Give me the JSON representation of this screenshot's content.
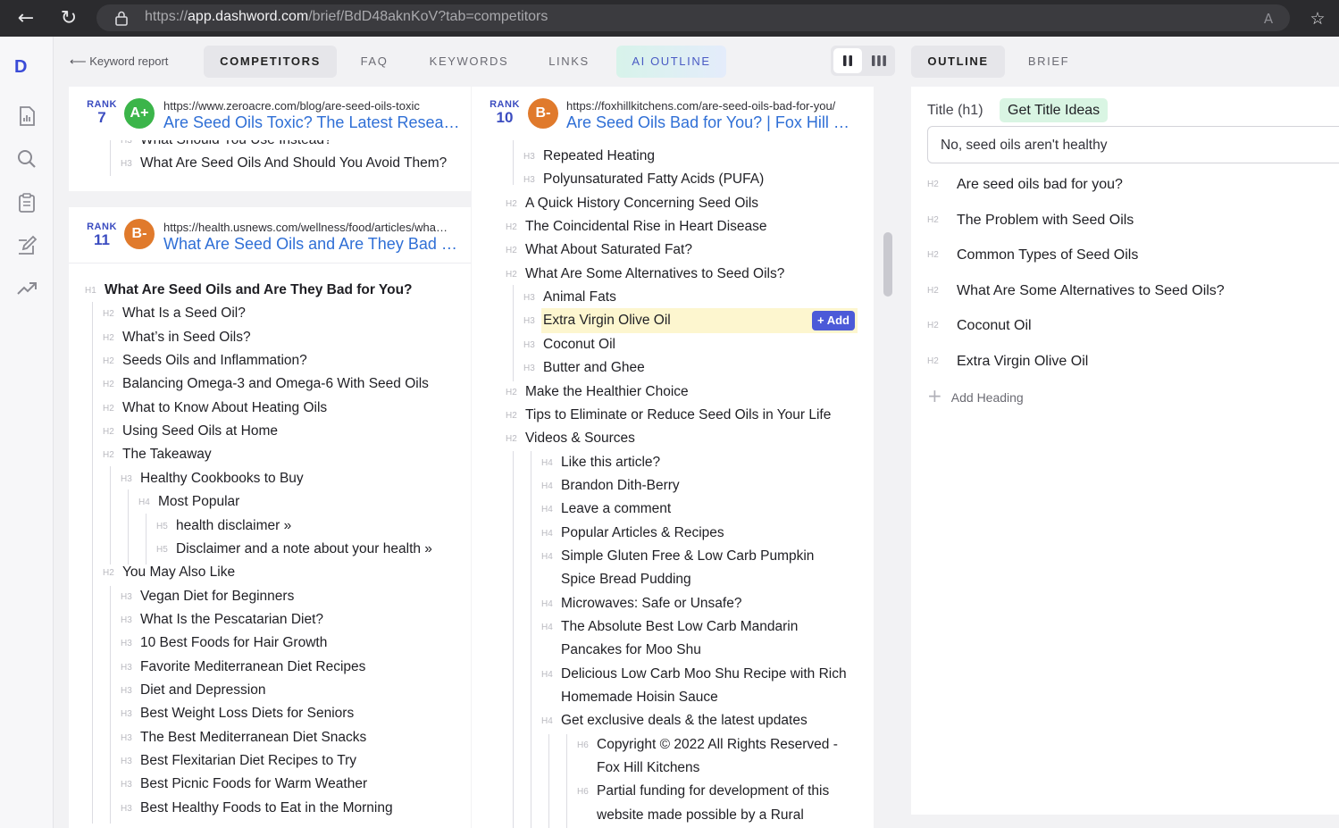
{
  "browser": {
    "url_prefix": "https://",
    "url_domain": "app.dashword.com",
    "url_path": "/brief/BdD48aknKoV?tab=competitors"
  },
  "app": {
    "logo": "D"
  },
  "nav": {
    "back_label": "Keyword report",
    "tabs": [
      "COMPETITORS",
      "FAQ",
      "KEYWORDS",
      "LINKS",
      "AI OUTLINE"
    ],
    "active_tab": "COMPETITORS",
    "right_tabs": [
      "OUTLINE",
      "BRIEF"
    ],
    "right_active": "OUTLINE"
  },
  "competitors": {
    "rank_label": "RANK",
    "left_top": {
      "rank": "7",
      "grade": "A+",
      "grade_color": "#3bb54a",
      "url": "https://www.zeroacre.com/blog/are-seed-oils-toxic",
      "title": "Are Seed Oils Toxic? The Latest Research",
      "headings": [
        {
          "level": "H3",
          "text": "What Should You Use Instead?"
        },
        {
          "level": "H3",
          "text": "What Are Seed Oils And Should You Avoid Them?"
        }
      ]
    },
    "left_main": {
      "rank": "11",
      "grade": "B-",
      "grade_color": "#e07a2c",
      "url": "https://health.usnews.com/wellness/food/articles/what-are-seed-oils",
      "title": "What Are Seed Oils and Are They Bad for You?",
      "headings": [
        {
          "level": "H1",
          "text": "What Are Seed Oils and Are They Bad for You?"
        },
        {
          "level": "H2",
          "text": "What Is a Seed Oil?"
        },
        {
          "level": "H2",
          "text": "What’s in Seed Oils?"
        },
        {
          "level": "H2",
          "text": "Seeds Oils and Inflammation?"
        },
        {
          "level": "H2",
          "text": "Balancing Omega-3 and Omega-6 With Seed Oils"
        },
        {
          "level": "H2",
          "text": "What to Know About Heating Oils"
        },
        {
          "level": "H2",
          "text": "Using Seed Oils at Home"
        },
        {
          "level": "H2",
          "text": "The Takeaway"
        },
        {
          "level": "H3",
          "text": "Healthy Cookbooks to Buy"
        },
        {
          "level": "H4",
          "text": "Most Popular"
        },
        {
          "level": "H5",
          "text": "health disclaimer »"
        },
        {
          "level": "H5",
          "text": "Disclaimer and a note about your health »"
        },
        {
          "level": "H2",
          "text": "You May Also Like"
        },
        {
          "level": "H3",
          "text": "Vegan Diet for Beginners"
        },
        {
          "level": "H3",
          "text": "What Is the Pescatarian Diet?"
        },
        {
          "level": "H3",
          "text": "10 Best Foods for Hair Growth"
        },
        {
          "level": "H3",
          "text": "Favorite Mediterranean Diet Recipes"
        },
        {
          "level": "H3",
          "text": "Diet and Depression"
        },
        {
          "level": "H3",
          "text": "Best Weight Loss Diets for Seniors"
        },
        {
          "level": "H3",
          "text": "The Best Mediterranean Diet Snacks"
        },
        {
          "level": "H3",
          "text": "Best Flexitarian Diet Recipes to Try"
        },
        {
          "level": "H3",
          "text": "Best Picnic Foods for Warm Weather"
        },
        {
          "level": "H3",
          "text": "Best Healthy Foods to Eat in the Morning"
        }
      ]
    },
    "middle": {
      "rank": "10",
      "grade": "B-",
      "grade_color": "#e07a2c",
      "url": "https://foxhillkitchens.com/are-seed-oils-bad-for-you/",
      "title": "Are Seed Oils Bad for You? | Fox Hill Kitchens",
      "add_label": "+ Add",
      "headings": [
        {
          "level": "H3",
          "text": "Repeated Heating"
        },
        {
          "level": "H3",
          "text": "Polyunsaturated Fatty Acids (PUFA)"
        },
        {
          "level": "H2",
          "text": "A Quick History Concerning Seed Oils"
        },
        {
          "level": "H2",
          "text": "The Coincidental Rise in Heart Disease"
        },
        {
          "level": "H2",
          "text": "What About Saturated Fat?"
        },
        {
          "level": "H2",
          "text": "What Are Some Alternatives to Seed Oils?"
        },
        {
          "level": "H3",
          "text": "Animal Fats"
        },
        {
          "level": "H3",
          "text": "Extra Virgin Olive Oil",
          "highlight": true
        },
        {
          "level": "H3",
          "text": "Coconut Oil"
        },
        {
          "level": "H3",
          "text": "Butter and Ghee"
        },
        {
          "level": "H2",
          "text": "Make the Healthier Choice"
        },
        {
          "level": "H2",
          "text": "Tips to Eliminate or Reduce Seed Oils in Your Life"
        },
        {
          "level": "H2",
          "text": "Videos & Sources"
        },
        {
          "level": "H4",
          "text": "Like this article?"
        },
        {
          "level": "H4",
          "text": "Brandon Dith-Berry"
        },
        {
          "level": "H4",
          "text": "Leave a comment"
        },
        {
          "level": "H4",
          "text": "Popular Articles & Recipes"
        },
        {
          "level": "H4",
          "text": "Simple Gluten Free & Low Carb Pumpkin",
          "cont": "Spice Bread Pudding"
        },
        {
          "level": "H4",
          "text": "Microwaves: Safe or Unsafe?"
        },
        {
          "level": "H4",
          "text": "The Absolute Best Low Carb Mandarin",
          "cont": "Pancakes for Moo Shu"
        },
        {
          "level": "H4",
          "text": "Delicious Low Carb Moo Shu Recipe with Rich",
          "cont": "Homemade Hoisin Sauce"
        },
        {
          "level": "H4",
          "text": "Get exclusive deals & the latest updates"
        },
        {
          "level": "H6",
          "text": "Copyright © 2022 All Rights Reserved -",
          "cont": "Fox Hill Kitchens"
        },
        {
          "level": "H6",
          "text": "Partial funding for development of this",
          "cont": "website made possible by a Rural"
        }
      ]
    }
  },
  "outline": {
    "title_label": "Title (h1)",
    "title_ideas_button": "Get Title Ideas",
    "title_value": "No, seed oils aren't healthy",
    "headings": [
      {
        "level": "H2",
        "text": "Are seed oils bad for you?"
      },
      {
        "level": "H2",
        "text": "The Problem with Seed Oils"
      },
      {
        "level": "H2",
        "text": "Common Types of Seed Oils"
      },
      {
        "level": "H2",
        "text": "What Are Some Alternatives to Seed Oils?"
      },
      {
        "level": "H2",
        "text": "Coconut Oil"
      },
      {
        "level": "H2",
        "text": "Extra Virgin Olive Oil"
      }
    ],
    "add_heading_label": "Add Heading"
  },
  "colors": {
    "accent": "#3a4bd7",
    "link": "#2f6fd6",
    "highlight": "#fdf6cf",
    "title_ideas_bg": "#d9f5e3"
  }
}
